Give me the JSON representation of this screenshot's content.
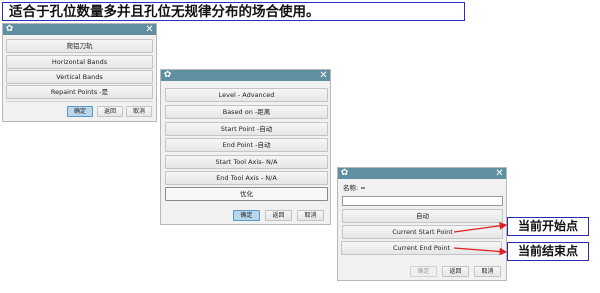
{
  "banner": {
    "text": "适合于孔位数量多并且孔位无规律分布的场合使用。"
  },
  "dialog1": {
    "items": [
      "爬铝刀轨",
      "Horizontal Bands",
      "Vertical Bands",
      "Repaint Points -是"
    ],
    "ok": "确定",
    "back": "返回",
    "cancel": "取消"
  },
  "dialog2": {
    "items": [
      "Level - Advanced",
      "Based on -距离",
      "Start Point -自动",
      "End Point -自动",
      "Start Tool Axis- N/A",
      "End Tool Axis - N/A",
      "优化"
    ],
    "ok": "确定",
    "back": "返回",
    "cancel": "取消"
  },
  "dialog3": {
    "name_label": "名称: =",
    "name_value": "",
    "items": [
      "自动",
      "Current Start Point",
      "Current End Point"
    ],
    "ok": "确定",
    "back": "返回",
    "cancel": "取消"
  },
  "callouts": {
    "start": "当前开始点",
    "end": "当前结束点"
  },
  "colors": {
    "titlebar": "#5f8fa0",
    "primary_button": "#b9d7ec",
    "arrow": "#e02020",
    "callout_border": "#2b2bb0"
  }
}
